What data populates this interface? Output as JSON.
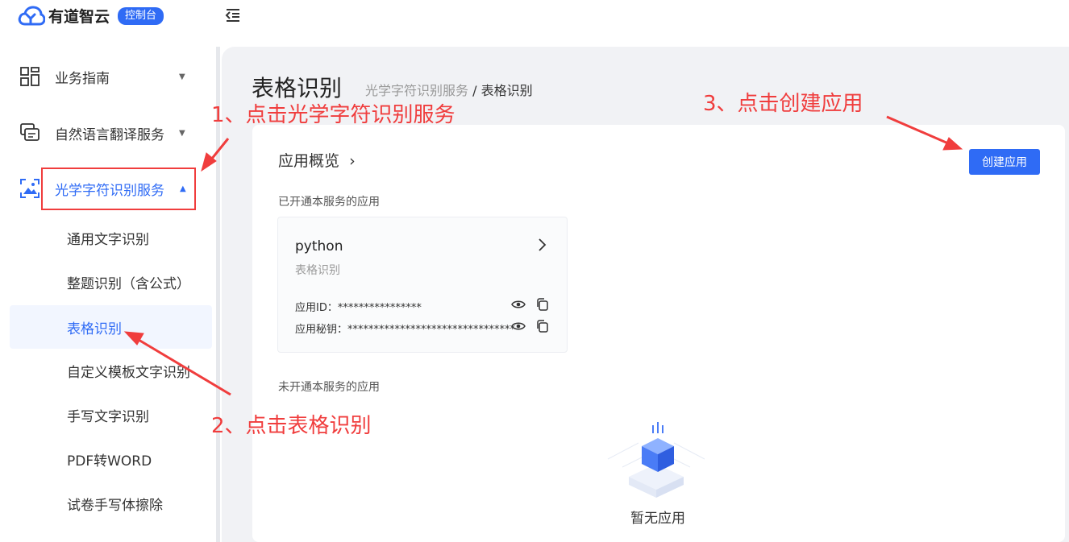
{
  "header": {
    "brand": "有道智云",
    "badge": "控制台"
  },
  "sidebar": {
    "items": [
      {
        "label": "业务指南",
        "icon": "grid-icon",
        "expanded": false
      },
      {
        "label": "自然语言翻译服务",
        "icon": "chat-translate-icon",
        "expanded": false
      },
      {
        "label": "光学字符识别服务",
        "icon": "scan-image-icon",
        "expanded": true
      }
    ],
    "sub_items": [
      {
        "label": "通用文字识别"
      },
      {
        "label": "整题识别（含公式）"
      },
      {
        "label": "表格识别",
        "active": true
      },
      {
        "label": "自定义模板文字识别"
      },
      {
        "label": "手写文字识别"
      },
      {
        "label": "PDF转WORD"
      },
      {
        "label": "试卷手写体擦除"
      }
    ]
  },
  "page": {
    "title": "表格识别",
    "breadcrumb_parent": "光学字符识别服务",
    "breadcrumb_sep": " / ",
    "breadcrumb_current": "表格识别"
  },
  "overview": {
    "title": "应用概览",
    "create_button": "创建应用",
    "enabled_section": "已开通本服务的应用",
    "disabled_section": "未开通本服务的应用",
    "empty_text": "暂无应用"
  },
  "app": {
    "name": "python",
    "service": "表格识别",
    "id_label": "应用ID：",
    "id_value": "****************",
    "secret_label": "应用秘钥：",
    "secret_value": "********************************"
  },
  "annotations": {
    "step1": "1、点击光学字符识别服务",
    "step2": "2、点击表格识别",
    "step3": "3、点击创建应用"
  },
  "colors": {
    "accent": "#2f6bf5",
    "annotation": "#f03d3d"
  }
}
